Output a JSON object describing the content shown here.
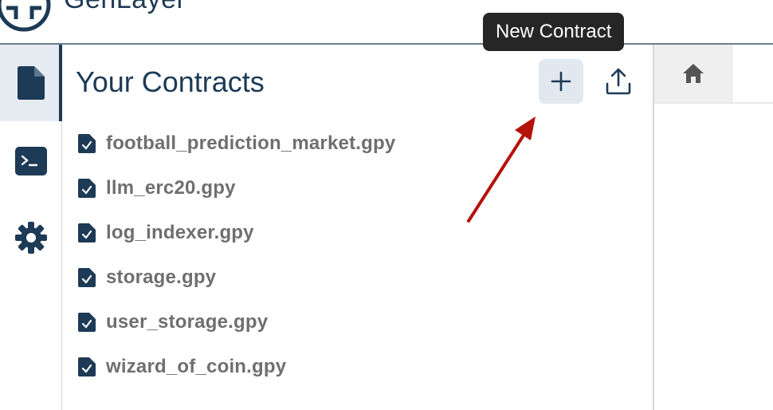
{
  "app": {
    "logo_text": "GenLayer"
  },
  "sidebar": {
    "items": [
      {
        "icon": "file-icon",
        "active": true
      },
      {
        "icon": "terminal-icon",
        "active": false
      },
      {
        "icon": "gear-icon",
        "active": false
      }
    ]
  },
  "contracts_panel": {
    "title": "Your Contracts",
    "new_contract_tooltip": "New Contract",
    "files": [
      "football_prediction_market.gpy",
      "llm_erc20.gpy",
      "log_indexer.gpy",
      "storage.gpy",
      "user_storage.gpy",
      "wizard_of_coin.gpy"
    ]
  },
  "tabs": {
    "home_icon": "home-icon"
  },
  "colors": {
    "brand_navy": "#1d3a56",
    "tooltip_bg": "#262626",
    "annotation_arrow": "#b4120b",
    "active_bg": "#e6ebf1"
  }
}
